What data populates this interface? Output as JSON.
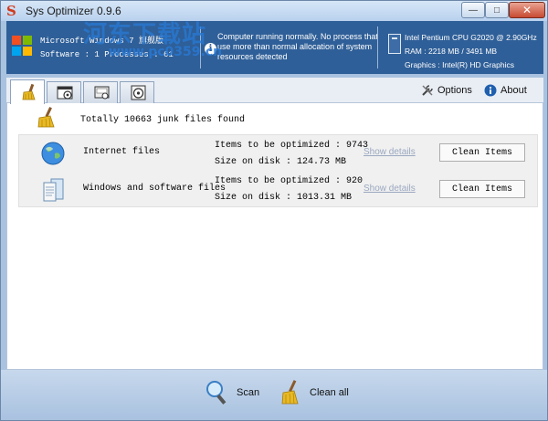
{
  "window": {
    "title": "Sys Optimizer 0.9.6",
    "minimize_glyph": "—",
    "maximize_glyph": "□",
    "close_glyph": "✕"
  },
  "watermark": {
    "text": "河东下载站",
    "url": "www.pc0359.cn"
  },
  "system": {
    "os_line": "Microsoft Windows 7 旗舰版",
    "software_line": "Software   : 1 Processes : 61",
    "status_line1": "Computer running normally. No process that",
    "status_line2": "use more than normal allocation of system",
    "status_line3": "resources detected",
    "cpu": "Intel Pentium CPU G2020 @ 2.90GHz",
    "ram": "RAM : 2218 MB / 3491 MB",
    "graphics": "Graphics : Intel(R) HD Graphics"
  },
  "toolbar": {
    "tabs": [
      {
        "icon": "broom-icon"
      },
      {
        "icon": "startup-icon"
      },
      {
        "icon": "disk-icon"
      },
      {
        "icon": "cd-icon"
      }
    ],
    "options_label": "Options",
    "about_label": "About"
  },
  "junk": {
    "summary": "Totally 10663 junk files found",
    "items": [
      {
        "name": "Internet files",
        "items_line": "Items to be optimized : 9743",
        "size_line": "Size on disk : 124.73 MB",
        "details_label": "Show details",
        "button_label": "Clean Items"
      },
      {
        "name": "Windows and software files",
        "items_line": "Items to be optimized : 920",
        "size_line": "Size on disk : 1013.31 MB",
        "details_label": "Show details",
        "button_label": "Clean Items"
      }
    ]
  },
  "bottom": {
    "scan_label": "Scan",
    "clean_all_label": "Clean all"
  },
  "colors": {
    "info_bar": "#2f5f98",
    "frame": "#a9c2e0",
    "link_disabled": "#9aa8c0"
  }
}
